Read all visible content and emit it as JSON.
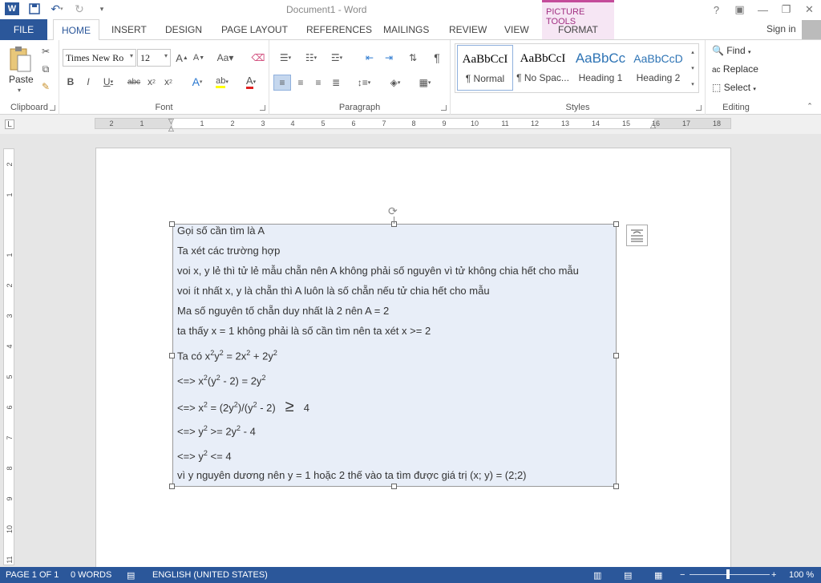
{
  "window": {
    "title": "Document1 - Word",
    "picture_tools": "PICTURE TOOLS",
    "sign_in": "Sign in"
  },
  "tabs": [
    "FILE",
    "HOME",
    "INSERT",
    "DESIGN",
    "PAGE LAYOUT",
    "REFERENCES",
    "MAILINGS",
    "REVIEW",
    "VIEW",
    "FORMAT"
  ],
  "ribbon": {
    "clipboard": {
      "label": "Clipboard",
      "paste": "Paste"
    },
    "font": {
      "label": "Font",
      "family": "Times New Ro",
      "size": "12"
    },
    "paragraph": {
      "label": "Paragraph"
    },
    "styles": {
      "label": "Styles",
      "items": [
        {
          "preview": "AaBbCcI",
          "name": "¶ Normal"
        },
        {
          "preview": "AaBbCcI",
          "name": "¶ No Spac..."
        },
        {
          "preview": "AaBbCc",
          "name": "Heading 1"
        },
        {
          "preview": "AaBbCcD",
          "name": "Heading 2"
        }
      ]
    },
    "editing": {
      "label": "Editing",
      "find": "Find",
      "replace": "Replace",
      "select": "Select"
    }
  },
  "ruler": {
    "ticks": [
      "2",
      "1",
      "1",
      "2",
      "3",
      "4",
      "5",
      "6",
      "7",
      "8",
      "9",
      "10",
      "11",
      "12",
      "13",
      "14",
      "15",
      "16",
      "17",
      "18"
    ]
  },
  "vruler": {
    "ticks": [
      "2",
      "1",
      "1",
      "2",
      "3",
      "4",
      "5",
      "6",
      "7",
      "8",
      "9",
      "10",
      "11"
    ]
  },
  "document": {
    "lines": [
      "Gọi số cần tìm là A",
      "Ta xét các trường hợp",
      "voi x, y lẻ thì tử lẻ mẫu chẵn nên A không phải số nguyên vì tử không chia hết cho mẫu",
      "voi ít nhất x, y là chẵn thì A luôn là số chẵn nếu tử chia hết cho mẫu",
      "Ma số nguyên tố chẵn duy nhất là 2 nên A = 2",
      "ta thấy x = 1 không phải là số cần tìm nên ta xét x >= 2"
    ],
    "eq1": {
      "a": "Ta có x",
      "b": "2",
      "c": "y",
      "d": "2",
      "e": " = 2x",
      "f": "2",
      "g": " + 2y",
      "h": "2"
    },
    "eq2": {
      "a": "<=> x",
      "b": "2",
      "c": "(y",
      "d": "2",
      "e": " - 2) = 2y",
      "f": "2"
    },
    "eq3": {
      "a": "<=> x",
      "b": "2",
      "c": " = (2y",
      "d": "2",
      "e": ")/(y",
      "f": "2",
      "g": " - 2)",
      "h": "≥",
      "i": "4"
    },
    "eq4": {
      "a": "<=> y",
      "b": "2",
      "c": " >= 2y",
      "d": "2",
      "e": " - 4"
    },
    "eq5": {
      "a": "<=> y",
      "b": "2",
      "c": " <= 4"
    },
    "last": "vì y nguyên dương nên y = 1 hoặc 2 thế vào ta tìm được giá trị (x; y) = (2;2)"
  },
  "status": {
    "page": "PAGE 1 OF 1",
    "words": "0 WORDS",
    "language": "ENGLISH (UNITED STATES)",
    "zoom": "100 %"
  }
}
